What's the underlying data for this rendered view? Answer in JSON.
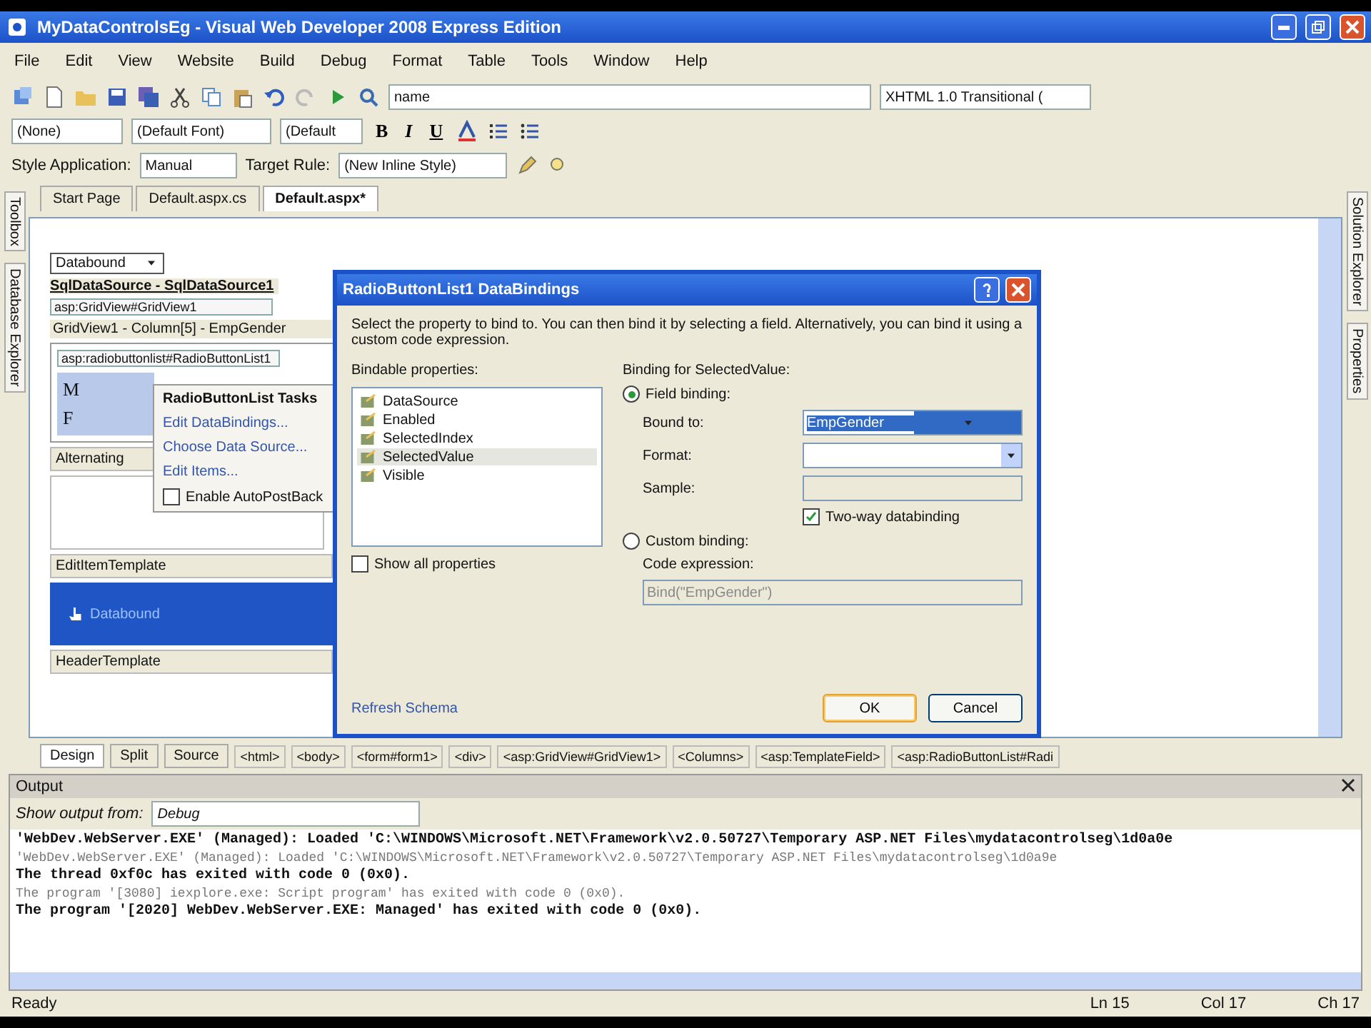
{
  "window": {
    "title": "MyDataControlsEg - Visual Web Developer 2008 Express Edition"
  },
  "menu": [
    "File",
    "Edit",
    "View",
    "Website",
    "Build",
    "Debug",
    "Format",
    "Table",
    "Tools",
    "Window",
    "Help"
  ],
  "toolbar_standard": {
    "element_field": "name",
    "doctype_field": "XHTML 1.0 Transitional ("
  },
  "toolbar_formatting": {
    "block_field": "(None)",
    "font_field": "(Default Font)",
    "size_field": "(Default",
    "bold": "B",
    "italic": "I",
    "underline": "U"
  },
  "toolbar_style": {
    "style_label": "Style Application:",
    "style_value": "Manual",
    "target_label": "Target Rule:",
    "target_value": "(New Inline Style)"
  },
  "left_strip": [
    "Toolbox",
    "Database Explorer"
  ],
  "right_strip": [
    "Solution Explorer",
    "Properties"
  ],
  "doc_tabs": [
    {
      "label": "Start Page",
      "selected": false
    },
    {
      "label": "Default.aspx.cs",
      "selected": false
    },
    {
      "label": "Default.aspx*",
      "selected": true
    }
  ],
  "designer": {
    "dropdown": "Databound",
    "datasource_label": "SqlDataSource - SqlDataSource1",
    "gridview_tag": "asp:GridView#GridView1",
    "gridview_caption": "GridView1 - Column[5] - EmpGender",
    "radiolist_tag": "asp:radiobuttonlist#RadioButtonList1",
    "radio_items": [
      "M",
      "F"
    ],
    "tasks": {
      "title": "RadioButtonList Tasks",
      "links": [
        "Edit DataBindings...",
        "Choose Data Source...",
        "Edit Items..."
      ],
      "autopostback": {
        "label": "Enable AutoPostBack",
        "checked": false
      }
    },
    "alternating_label": "Alternating",
    "edit_template_label": "EditItemTemplate",
    "edit_template_item": "Databound",
    "header_template_label": "HeaderTemplate"
  },
  "view_tabs": [
    {
      "label": "Design",
      "selected": true
    },
    {
      "label": "Split",
      "selected": false
    },
    {
      "label": "Source",
      "selected": false
    }
  ],
  "breadcrumbs": [
    "<html>",
    "<body>",
    "<form#form1>",
    "<div>",
    "<asp:GridView#GridView1>",
    "<Columns>",
    "<asp:TemplateField>",
    "<asp:RadioButtonList#Radi"
  ],
  "dialog": {
    "title": "RadioButtonList1 DataBindings",
    "description": "Select the property to bind to. You can then bind it by selecting a field. Alternatively, you can bind it using a custom code expression.",
    "bindable_label": "Bindable properties:",
    "properties": [
      {
        "name": "DataSource",
        "selected": false
      },
      {
        "name": "Enabled",
        "selected": false
      },
      {
        "name": "SelectedIndex",
        "selected": false
      },
      {
        "name": "SelectedValue",
        "selected": true
      },
      {
        "name": "Visible",
        "selected": false
      }
    ],
    "show_all": {
      "label": "Show all properties",
      "checked": false
    },
    "binding_label": "Binding for SelectedValue:",
    "field_binding": {
      "label": "Field binding:",
      "selected": true
    },
    "bound_to": {
      "label": "Bound to:",
      "value": "EmpGender"
    },
    "format": {
      "label": "Format:"
    },
    "sample": {
      "label": "Sample:"
    },
    "two_way": {
      "label": "Two-way databinding",
      "checked": true
    },
    "custom_binding": {
      "label": "Custom binding:",
      "selected": false
    },
    "code_expression": {
      "label": "Code expression:",
      "value": "Bind(\"EmpGender\")"
    },
    "refresh_link": "Refresh Schema",
    "buttons": [
      "OK",
      "Cancel"
    ]
  },
  "output": {
    "title": "Output",
    "show_label": "Show output from:",
    "source": "Debug",
    "lines": [
      {
        "text": "'WebDev.WebServer.EXE' (Managed): Loaded 'C:\\WINDOWS\\Microsoft.NET\\Framework\\v2.0.50727\\Temporary ASP.NET Files\\mydatacontrolseg\\1d0a0e",
        "kind": "bold"
      },
      {
        "text": "'WebDev.WebServer.EXE' (Managed): Loaded 'C:\\WINDOWS\\Microsoft.NET\\Framework\\v2.0.50727\\Temporary ASP.NET Files\\mydatacontrolseg\\1d0a9e",
        "kind": "faint"
      },
      {
        "text": "The thread 0xf0c has exited with code 0 (0x0).",
        "kind": "bold"
      },
      {
        "text": "The program '[3080] iexplore.exe: Script program' has exited with code 0 (0x0).",
        "kind": "faint"
      },
      {
        "text": "The program '[2020] WebDev.WebServer.EXE: Managed' has exited with code 0 (0x0).",
        "kind": "bold"
      }
    ]
  },
  "status_bar": {
    "text": "Ready",
    "line": "Ln 15",
    "col": "Col 17",
    "ch": "Ch 17"
  }
}
